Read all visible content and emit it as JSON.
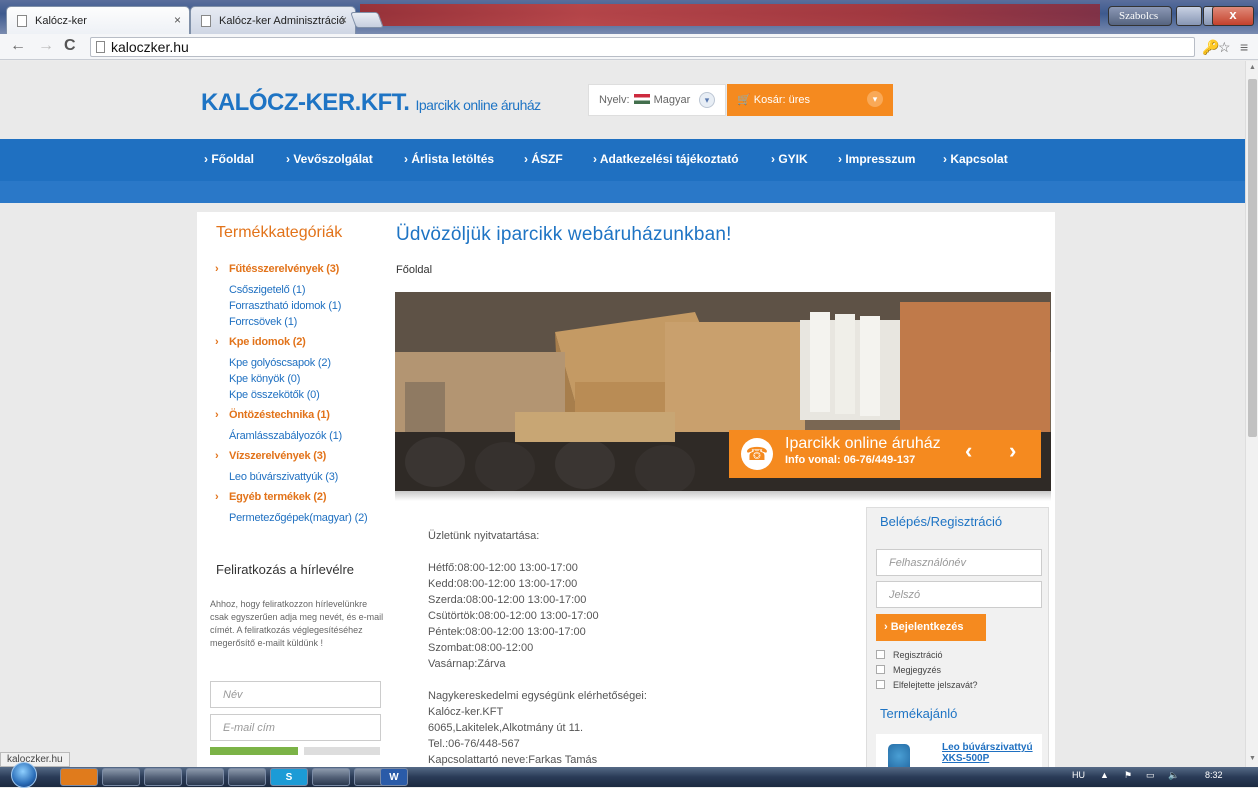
{
  "browser": {
    "tabs": [
      {
        "title": "Kalócz-ker",
        "close": "×"
      },
      {
        "title": "Kalócz-ker Adminisztráció",
        "close": "×"
      }
    ],
    "user": "Szabolcs",
    "window_close": "x",
    "url": "kaloczker.hu",
    "status_url": "kaloczker.hu"
  },
  "header": {
    "logo": "KALÓCZ-KER.KFT.",
    "tagline": "Iparcikk online áruház",
    "language_label": "Nyelv:",
    "language_value": "Magyar",
    "cart_label": "Kosár: üres"
  },
  "nav": {
    "items": [
      "Főoldal",
      "Vevőszolgálat",
      "Árlista letöltés",
      "ÁSZF",
      "Adatkezelési tájékoztató",
      "GYIK",
      "Impresszum",
      "Kapcsolat"
    ]
  },
  "sidebar": {
    "title": "Termékkategóriák",
    "categories": [
      {
        "label": "Fűtésszerelvények (3)",
        "subs": [
          "Csőszigetelő (1)",
          "Forrasztható idomok (1)",
          "Forrcsövek (1)"
        ]
      },
      {
        "label": "Kpe idomok (2)",
        "subs": [
          "Kpe golyóscsapok (2)",
          "Kpe könyök (0)",
          "Kpe összekötők (0)"
        ]
      },
      {
        "label": "Öntözéstechnika (1)",
        "subs": [
          "Áramlásszabályozók (1)"
        ]
      },
      {
        "label": "Vízszerelvények (3)",
        "subs": [
          "Leo búvárszivattyúk (3)"
        ]
      },
      {
        "label": "Egyéb termékek (2)",
        "subs": [
          "Permetezőgépek(magyar) (2)"
        ]
      }
    ],
    "newsletter_title": "Feliratkozás a hírlevélre",
    "newsletter_text": "Ahhoz, hogy feliratkozzon hírlevelünkre csak egyszerűen adja meg nevét, és e-mail címét. A feliratkozás véglegesítéséhez megerősítő e-mailt küldünk !",
    "name_placeholder": "Név",
    "email_placeholder": "E-mail cím"
  },
  "main": {
    "title": "Üdvözöljük iparcikk webáruházunkban!",
    "breadcrumb": "Főoldal",
    "banner_title": "Iparcikk online áruház",
    "banner_phone": "Info vonal: 06-76/449-137",
    "hours_title": "Üzletünk nyitvatartása:",
    "hours": [
      "Hétfő:08:00-12:00 13:00-17:00",
      "Kedd:08:00-12:00 13:00-17:00",
      "Szerda:08:00-12:00 13:00-17:00",
      "Csütörtök:08:00-12:00 13:00-17:00",
      "Péntek:08:00-12:00 13:00-17:00",
      "Szombat:08:00-12:00",
      "Vasárnap:Zárva"
    ],
    "contact_title": "Nagykereskedelmi egységünk elérhetőségei:",
    "contact": [
      "Kalócz-ker.KFT",
      "6065,Lakitelek,Alkotmány út 11.",
      "Tel.:06-76/448-567",
      "Kapcsolattartó neve:Farkas Tamás"
    ]
  },
  "login": {
    "title": "Belépés/Regisztráció",
    "username_placeholder": "Felhasználónév",
    "password_placeholder": "Jelszó",
    "button": "Bejelentkezés",
    "options": [
      "Regisztráció",
      "Megjegyzés",
      "Elfelejtette jelszavát?"
    ],
    "products_title": "Termékajánló",
    "product_name_1": "Leo búvárszivattyú",
    "product_name_2": "XKS-500P"
  },
  "taskbar": {
    "lang": "HU",
    "time": "8:32",
    "apps": [
      "",
      "",
      "",
      "",
      "",
      "S",
      "",
      "",
      "W"
    ]
  }
}
